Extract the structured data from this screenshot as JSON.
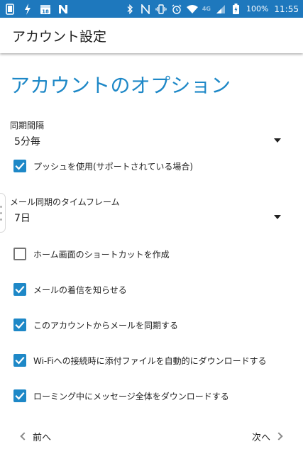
{
  "status_bar": {
    "left_icons": [
      "screen-icon",
      "flash-icon",
      "calendar-icon",
      "n-logo-icon"
    ],
    "right_icons": [
      "bluetooth-icon",
      "nfc-icon",
      "vibrate-icon",
      "alarm-icon",
      "wifi-icon",
      "signal-icon",
      "battery-icon"
    ],
    "calendar_day": "18",
    "network": "4G",
    "battery": "100%",
    "time": "11:55",
    "color": "#1e78bd"
  },
  "appbar": {
    "title": "アカウント設定"
  },
  "heading": "アカウントのオプション",
  "accent_color": "#1e88c7",
  "sync_interval": {
    "label": "同期間隔",
    "value": "5分毎"
  },
  "push": {
    "label": "プッシュを使用(サポートされている場合)",
    "checked": true
  },
  "sync_timeframe": {
    "label": "メール同期のタイムフレーム",
    "value": "7日"
  },
  "options": [
    {
      "label": "ホーム画面のショートカットを作成",
      "checked": false
    },
    {
      "label": "メールの着信を知らせる",
      "checked": true
    },
    {
      "label": "このアカウントからメールを同期する",
      "checked": true
    },
    {
      "label": "Wi-Fiへの接続時に添付ファイルを自動的にダウンロードする",
      "checked": true
    },
    {
      "label": "ローミング中にメッセージ全体をダウンロードする",
      "checked": true
    }
  ],
  "nav": {
    "prev": "前へ",
    "next": "次へ"
  }
}
